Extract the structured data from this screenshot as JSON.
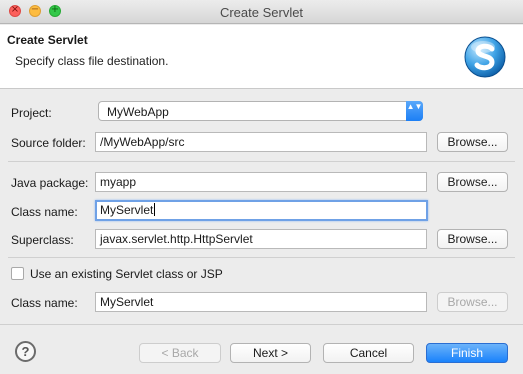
{
  "window": {
    "title": "Create Servlet",
    "controls": {
      "close": "×",
      "minimize": "−",
      "maximize": "+"
    }
  },
  "banner": {
    "title": "Create Servlet",
    "description": "Specify class file destination.",
    "logo_icon": "servlet-s-logo"
  },
  "form": {
    "project": {
      "label": "Project:",
      "value": "MyWebApp",
      "arrows": "▲▼"
    },
    "source_folder": {
      "label": "Source folder:",
      "value": "/MyWebApp/src",
      "browse": "Browse..."
    },
    "java_package": {
      "label": "Java package:",
      "value": "myapp",
      "browse": "Browse..."
    },
    "class_name": {
      "label": "Class name:",
      "value": "MyServlet"
    },
    "superclass": {
      "label": "Superclass:",
      "value": "javax.servlet.http.HttpServlet",
      "browse": "Browse..."
    },
    "use_existing": {
      "label": "Use an existing Servlet class or JSP",
      "checked": false
    },
    "existing_class": {
      "label": "Class name:",
      "value": "MyServlet",
      "browse": "Browse..."
    }
  },
  "footer": {
    "help": "?",
    "back": "< Back",
    "next": "Next >",
    "cancel": "Cancel",
    "finish": "Finish"
  },
  "colors": {
    "accent": "#1a82fb",
    "focus_ring": "#6fa1e6"
  }
}
